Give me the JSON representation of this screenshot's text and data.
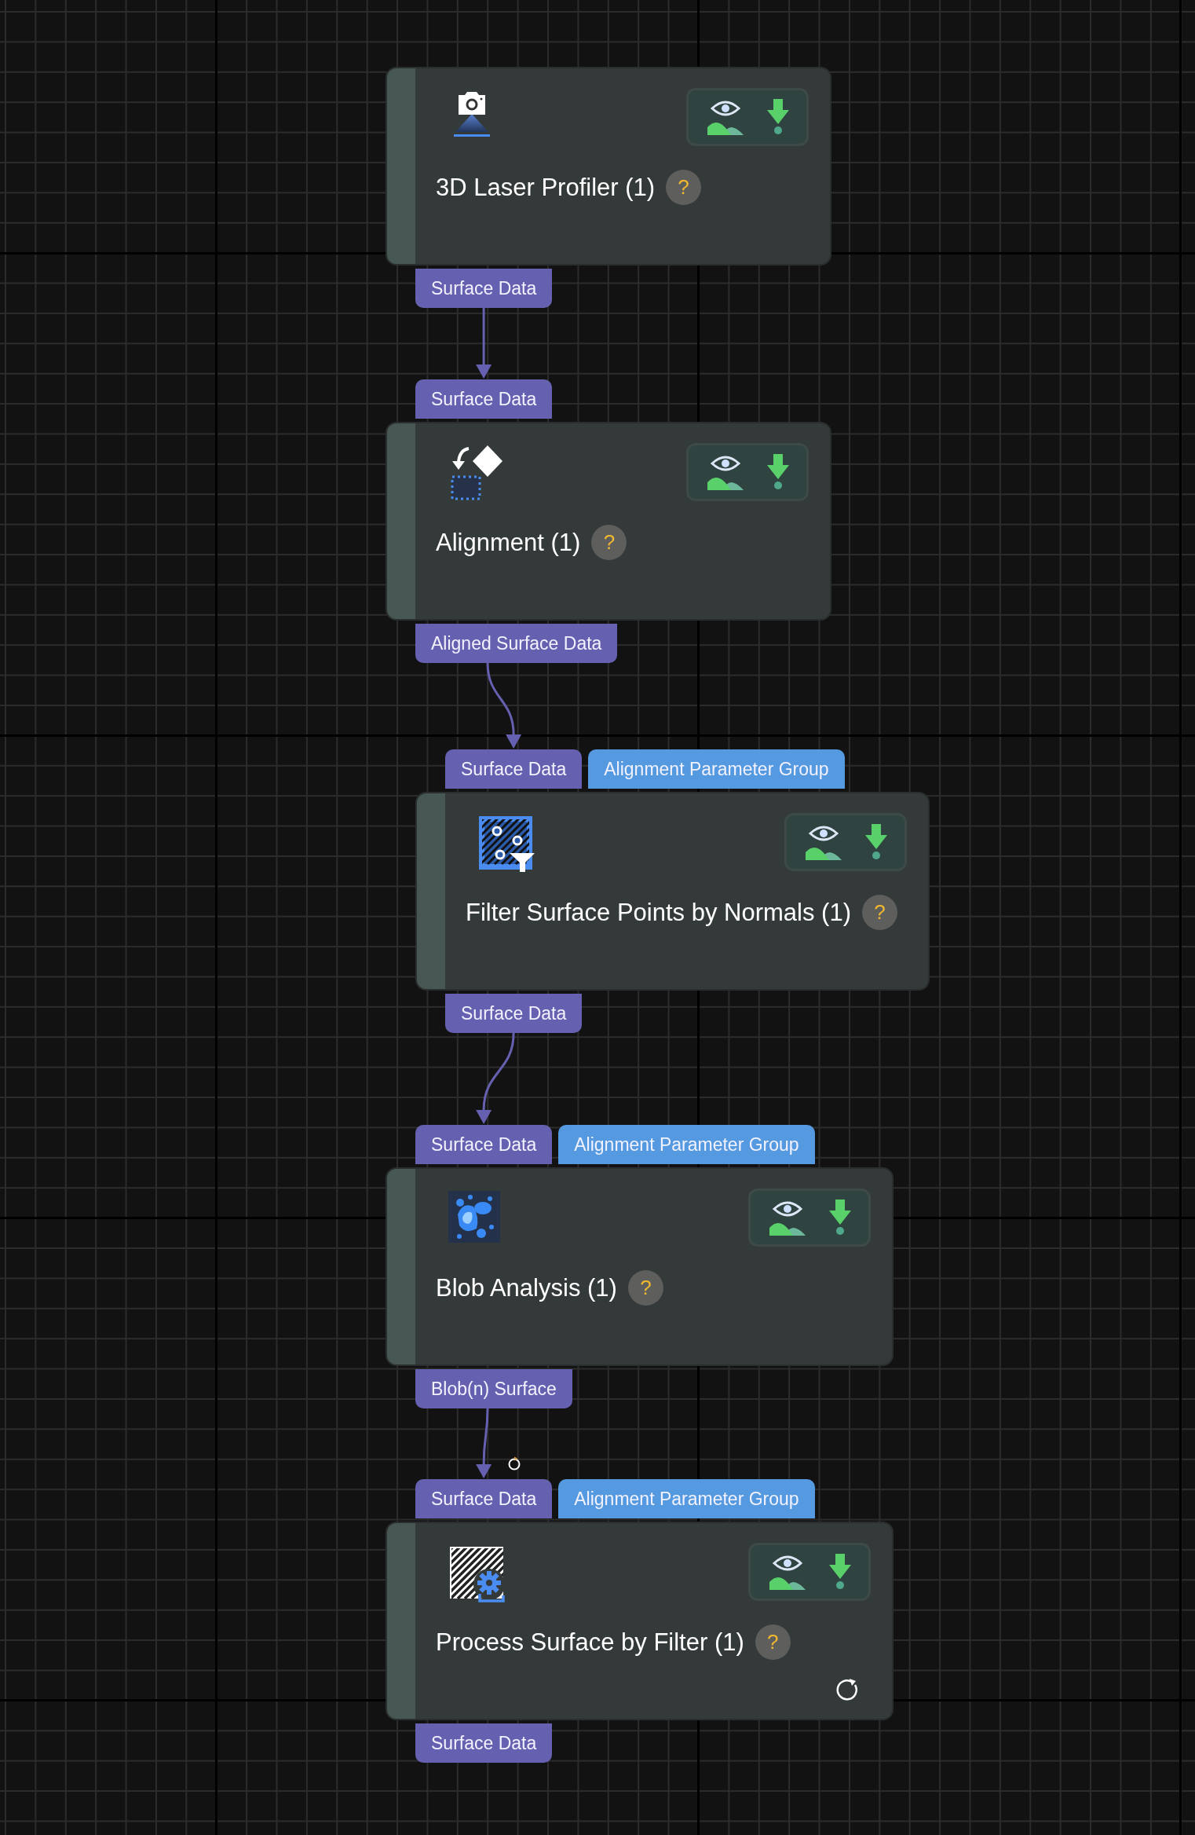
{
  "nodes": [
    {
      "kind": "camera",
      "title": "3D Laser Profiler (1)",
      "help": "?",
      "refresh": false,
      "outputs": [
        {
          "label": "Surface Data",
          "kind": "data"
        }
      ]
    },
    {
      "kind": "alignment",
      "title": "Alignment (1)",
      "help": "?",
      "refresh": false,
      "inputs": [
        {
          "label": "Surface Data",
          "kind": "data"
        }
      ],
      "outputs": [
        {
          "label": "Aligned Surface Data",
          "kind": "data"
        }
      ]
    },
    {
      "kind": "filter_points",
      "title": "Filter Surface Points by Normals (1)",
      "help": "?",
      "refresh": false,
      "inputs": [
        {
          "label": "Surface Data",
          "kind": "data"
        },
        {
          "label": "Alignment Parameter Group",
          "kind": "parameter"
        }
      ],
      "outputs": [
        {
          "label": "Surface Data",
          "kind": "data"
        }
      ]
    },
    {
      "kind": "blob",
      "title": "Blob Analysis (1)",
      "help": "?",
      "refresh": false,
      "inputs": [
        {
          "label": "Surface Data",
          "kind": "data"
        },
        {
          "label": "Alignment Parameter Group",
          "kind": "parameter"
        }
      ],
      "outputs": [
        {
          "label": "Blob(n) Surface",
          "kind": "data"
        }
      ]
    },
    {
      "kind": "process_filter",
      "title": "Process Surface by Filter (1)",
      "help": "?",
      "refresh": true,
      "inputs": [
        {
          "label": "Surface Data",
          "kind": "data"
        },
        {
          "label": "Alignment Parameter Group",
          "kind": "parameter"
        }
      ],
      "outputs": [
        {
          "label": "Surface Data",
          "kind": "data"
        }
      ]
    }
  ],
  "cursor": {
    "kind": "busy"
  }
}
